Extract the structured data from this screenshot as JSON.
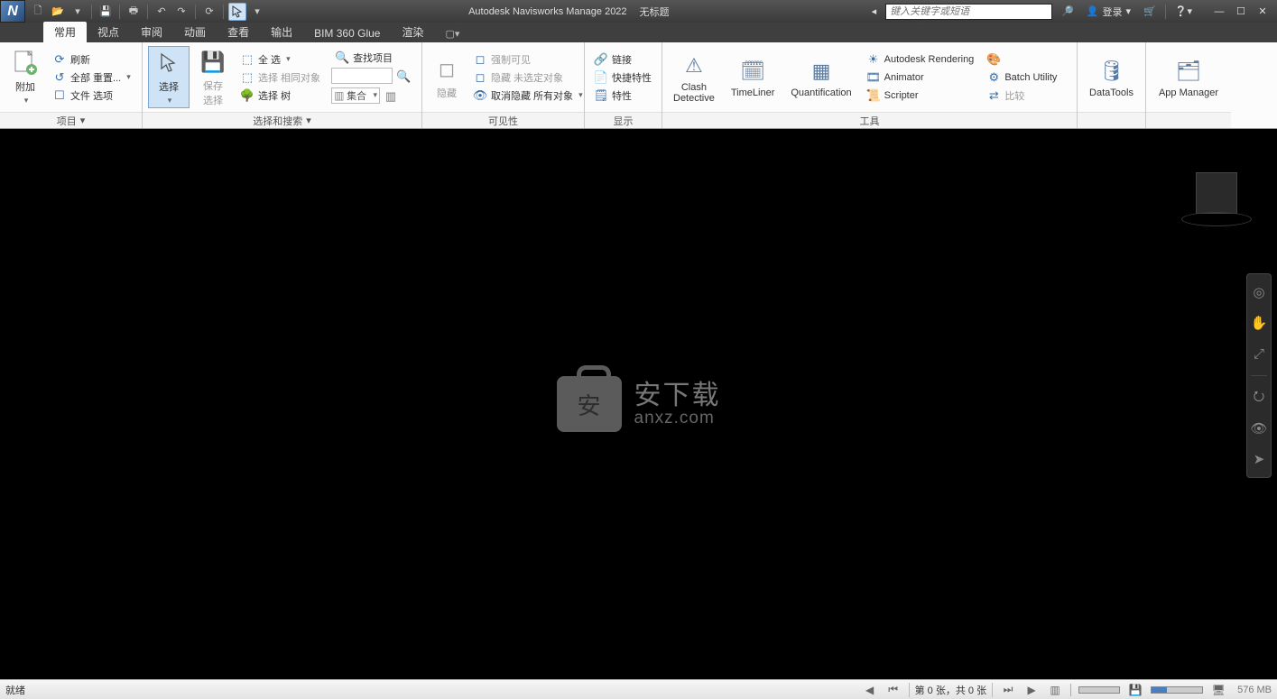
{
  "title": {
    "app": "Autodesk Navisworks Manage 2022",
    "doc": "无标题"
  },
  "search": {
    "placeholder": "键入关键字或短语"
  },
  "user": {
    "login": "登录"
  },
  "tabs": [
    "常用",
    "视点",
    "审阅",
    "动画",
    "查看",
    "输出",
    "BIM 360 Glue",
    "渲染"
  ],
  "active_tab": "常用",
  "panels": {
    "project": {
      "title": "项目",
      "append": "附加",
      "refresh": "刷新",
      "reset_all": "全部 重置...",
      "file_options": "文件 选项"
    },
    "select_search": {
      "title": "选择和搜索",
      "select": "选择",
      "save_sel": "保存\n选择",
      "select_all": "全 选",
      "select_same": "选择 相同对象",
      "select_tree": "选择 树",
      "find_items": "查找项目",
      "quick_find_placeholder": "",
      "sets": "集合"
    },
    "visibility": {
      "title": "可见性",
      "hide": "隐藏",
      "force_visible": "强制可见",
      "hide_unselected": "隐藏 未选定对象",
      "unhide_all": "取消隐藏 所有对象"
    },
    "display": {
      "title": "显示",
      "links": "链接",
      "quick_props": "快捷特性",
      "props": "特性"
    },
    "tools": {
      "title": "工具",
      "clash": "Clash\nDetective",
      "timeliner": "TimeLiner",
      "quantification": "Quantification",
      "rendering": "Autodesk Rendering",
      "animator": "Animator",
      "scripter": "Scripter",
      "batch": "Batch Utility",
      "compare": "比较",
      "datatools": "DataTools",
      "appmanager": "App Manager"
    }
  },
  "watermark": {
    "line1": "安下载",
    "line2": "anxz.com"
  },
  "status": {
    "ready": "就绪",
    "page": "第 0 张，共 0 张",
    "mem": "576 MB"
  }
}
